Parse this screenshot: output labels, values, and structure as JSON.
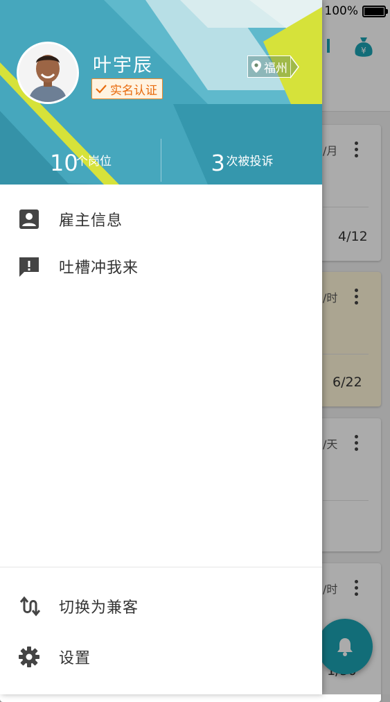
{
  "status_bar": {
    "battery": "100%"
  },
  "background": {
    "cards": [
      {
        "rate": "/月",
        "date": "4/12"
      },
      {
        "rate": "/时",
        "date": "6/22"
      },
      {
        "rate": "/天",
        "date": ""
      },
      {
        "rate": "/时",
        "date": "1/30"
      }
    ],
    "icons": [
      "list-icon",
      "money-bag-icon",
      "bell-icon"
    ]
  },
  "drawer": {
    "user": {
      "name": "叶宇辰",
      "verified_label": "实名认证",
      "location": "福州"
    },
    "stats": [
      {
        "value": "10",
        "unit": "个岗位"
      },
      {
        "value": "3",
        "unit": "次被投诉"
      }
    ],
    "menu": [
      {
        "label": "雇主信息",
        "icon": "contact-card-icon"
      },
      {
        "label": "吐槽冲我来",
        "icon": "feedback-icon"
      }
    ],
    "bottom_menu": [
      {
        "label": "切换为兼客",
        "icon": "switch-arrows-icon"
      },
      {
        "label": "设置",
        "icon": "gear-icon"
      }
    ]
  },
  "colors": {
    "accent": "#1ba3b3",
    "header_teal": "#3a9fb6",
    "header_yellow": "#d6e23a",
    "badge_orange": "#e86a0c"
  }
}
